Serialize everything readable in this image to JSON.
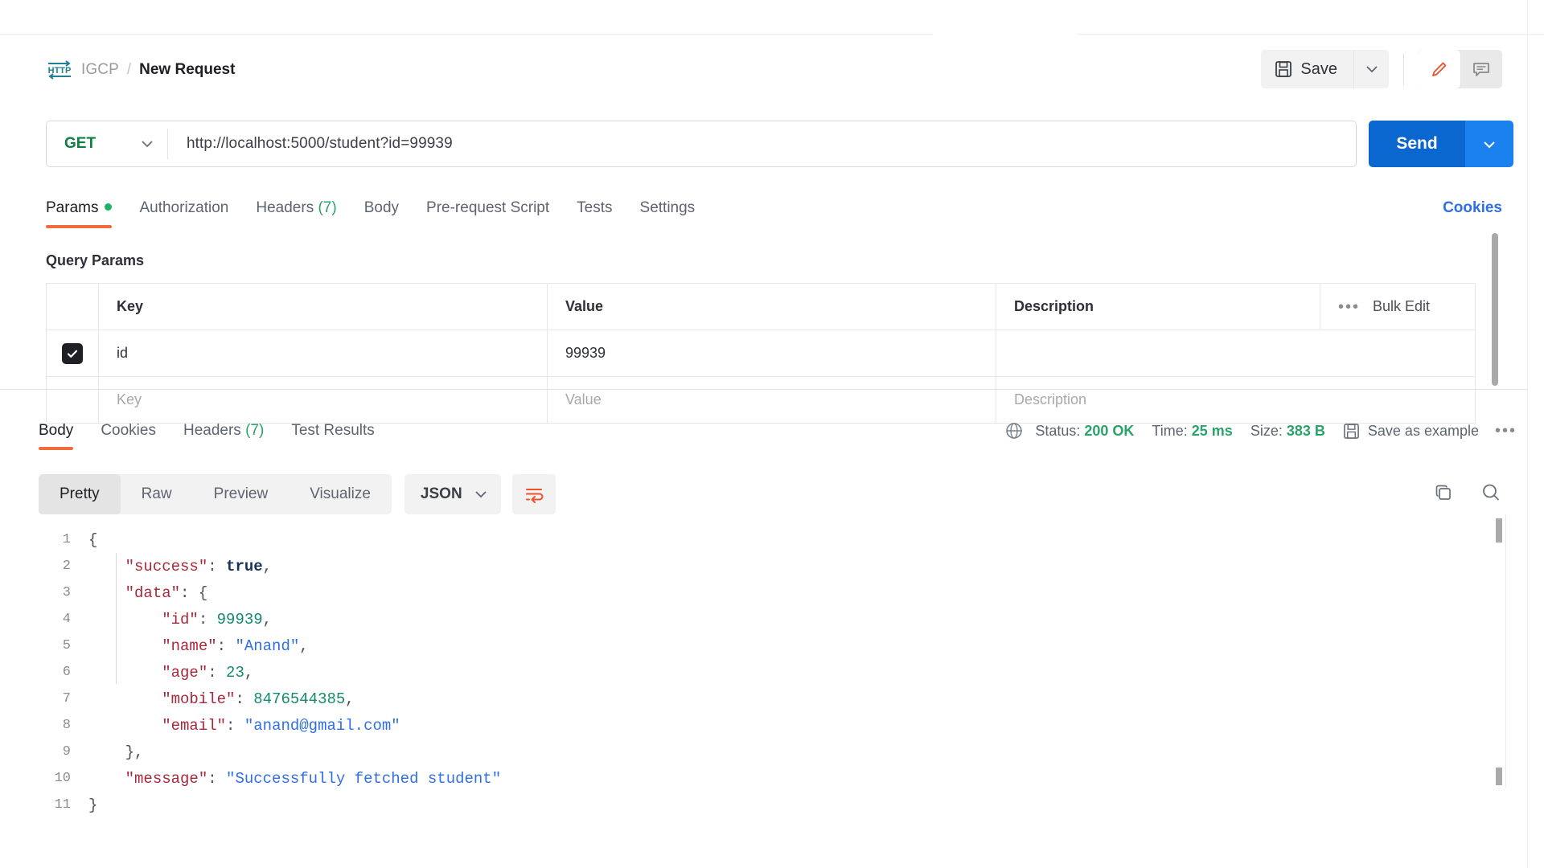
{
  "breadcrumb": {
    "icon": "http-icon",
    "parent": "IGCP",
    "separator": "/",
    "current": "New Request"
  },
  "toolbar": {
    "save_label": "Save",
    "save_icon": "floppy-disk-icon",
    "save_caret_icon": "chevron-down-icon",
    "edit_icon": "pencil-icon",
    "comment_icon": "comment-icon",
    "edit_accent_color": "#f0502b"
  },
  "url_bar": {
    "method": "GET",
    "method_color": "#0c8043",
    "method_caret_icon": "chevron-down-icon",
    "url": "http://localhost:5000/student?id=99939"
  },
  "send": {
    "label": "Send",
    "caret_icon": "chevron-down-icon",
    "color": "#0b67d0",
    "caret_color": "#1a81ef"
  },
  "request_tabs": {
    "items": [
      {
        "label": "Params",
        "active": true,
        "dot": true
      },
      {
        "label": "Authorization",
        "active": false
      },
      {
        "label": "Headers",
        "count": "(7)",
        "active": false
      },
      {
        "label": "Body",
        "active": false
      },
      {
        "label": "Pre-request Script",
        "active": false
      },
      {
        "label": "Tests",
        "active": false
      },
      {
        "label": "Settings",
        "active": false
      }
    ],
    "cookies_link": "Cookies",
    "active_underline_color": "#f26b3a",
    "dot_color": "#18b566"
  },
  "query_params": {
    "title": "Query Params",
    "columns": [
      "Key",
      "Value",
      "Description"
    ],
    "bulk_edit_label": "Bulk Edit",
    "bulk_edit_icon": "ellipsis-icon",
    "rows": [
      {
        "checked": true,
        "key": "id",
        "value": "99939",
        "description": ""
      }
    ],
    "placeholder_row": {
      "key": "Key",
      "value": "Value",
      "description": "Description"
    }
  },
  "response_tabs": {
    "items": [
      {
        "label": "Body",
        "active": true
      },
      {
        "label": "Cookies",
        "active": false
      },
      {
        "label": "Headers",
        "count": "(7)",
        "active": false
      },
      {
        "label": "Test Results",
        "active": false
      }
    ]
  },
  "response_meta": {
    "globe_icon": "globe-icon",
    "status_label": "Status:",
    "status_value": "200 OK",
    "time_label": "Time:",
    "time_value": "25 ms",
    "size_label": "Size:",
    "size_value": "383 B",
    "save_example_label": "Save as example",
    "save_example_icon": "floppy-disk-icon",
    "more_icon": "ellipsis-icon",
    "value_color": "#2aa36b"
  },
  "response_toolbar": {
    "views": [
      {
        "label": "Pretty",
        "active": true
      },
      {
        "label": "Raw",
        "active": false
      },
      {
        "label": "Preview",
        "active": false
      },
      {
        "label": "Visualize",
        "active": false
      }
    ],
    "format": "JSON",
    "format_caret_icon": "chevron-down-icon",
    "wrap_icon": "word-wrap-icon",
    "wrap_icon_color": "#f0502b",
    "copy_icon": "copy-icon",
    "search_icon": "search-icon"
  },
  "response_body": {
    "language": "json",
    "lines": [
      {
        "num": "1",
        "tokens": [
          {
            "t": "{",
            "c": "p"
          }
        ]
      },
      {
        "num": "2",
        "tokens": [
          {
            "t": "    ",
            "c": "p"
          },
          {
            "t": "\"success\"",
            "c": "k"
          },
          {
            "t": ": ",
            "c": "p"
          },
          {
            "t": "true",
            "c": "b"
          },
          {
            "t": ",",
            "c": "p"
          }
        ]
      },
      {
        "num": "3",
        "tokens": [
          {
            "t": "    ",
            "c": "p"
          },
          {
            "t": "\"data\"",
            "c": "k"
          },
          {
            "t": ": {",
            "c": "p"
          }
        ]
      },
      {
        "num": "4",
        "tokens": [
          {
            "t": "        ",
            "c": "p"
          },
          {
            "t": "\"id\"",
            "c": "k"
          },
          {
            "t": ": ",
            "c": "p"
          },
          {
            "t": "99939",
            "c": "n"
          },
          {
            "t": ",",
            "c": "p"
          }
        ]
      },
      {
        "num": "5",
        "tokens": [
          {
            "t": "        ",
            "c": "p"
          },
          {
            "t": "\"name\"",
            "c": "k"
          },
          {
            "t": ": ",
            "c": "p"
          },
          {
            "t": "\"Anand\"",
            "c": "s"
          },
          {
            "t": ",",
            "c": "p"
          }
        ]
      },
      {
        "num": "6",
        "tokens": [
          {
            "t": "        ",
            "c": "p"
          },
          {
            "t": "\"age\"",
            "c": "k"
          },
          {
            "t": ": ",
            "c": "p"
          },
          {
            "t": "23",
            "c": "n"
          },
          {
            "t": ",",
            "c": "p"
          }
        ]
      },
      {
        "num": "7",
        "tokens": [
          {
            "t": "        ",
            "c": "p"
          },
          {
            "t": "\"mobile\"",
            "c": "k"
          },
          {
            "t": ": ",
            "c": "p"
          },
          {
            "t": "8476544385",
            "c": "n"
          },
          {
            "t": ",",
            "c": "p"
          }
        ]
      },
      {
        "num": "8",
        "tokens": [
          {
            "t": "        ",
            "c": "p"
          },
          {
            "t": "\"email\"",
            "c": "k"
          },
          {
            "t": ": ",
            "c": "p"
          },
          {
            "t": "\"anand@gmail.com\"",
            "c": "s"
          }
        ]
      },
      {
        "num": "9",
        "tokens": [
          {
            "t": "    },",
            "c": "p"
          }
        ]
      },
      {
        "num": "10",
        "tokens": [
          {
            "t": "    ",
            "c": "p"
          },
          {
            "t": "\"message\"",
            "c": "k"
          },
          {
            "t": ": ",
            "c": "p"
          },
          {
            "t": "\"Successfully fetched student\"",
            "c": "s"
          }
        ]
      },
      {
        "num": "11",
        "tokens": [
          {
            "t": "}",
            "c": "p"
          }
        ]
      }
    ]
  }
}
